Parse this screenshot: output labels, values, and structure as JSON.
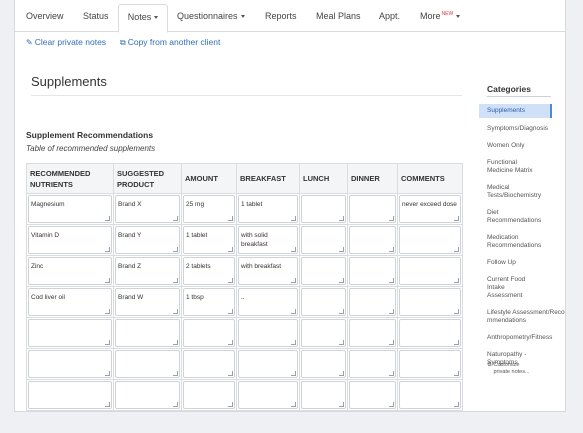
{
  "tabs": [
    {
      "label": "Overview"
    },
    {
      "label": "Status"
    },
    {
      "label": "Notes",
      "dropdown": true,
      "active": true
    },
    {
      "label": "Questionnaires",
      "dropdown": true
    },
    {
      "label": "Reports"
    },
    {
      "label": "Meal Plans"
    },
    {
      "label": "Appt."
    },
    {
      "label": "More",
      "dropdown": true,
      "badge": "NEW"
    }
  ],
  "actions": {
    "clear_label": "Clear private notes",
    "copy_label": "Copy from another client"
  },
  "page": {
    "title": "Supplements",
    "section_title": "Supplement Recommendations",
    "section_subtitle": "Table of recommended supplements"
  },
  "table": {
    "headers": [
      "RECOMMENDED NUTRIENTS",
      "SUGGESTED PRODUCT",
      "AMOUNT",
      "BREAKFAST",
      "LUNCH",
      "DINNER",
      "COMMENTS"
    ],
    "rows": [
      [
        "Magnesium",
        "Brand X",
        "25 mg",
        "1 tablet",
        "",
        "",
        "never exceed dose"
      ],
      [
        "Vitamin D",
        "Brand Y",
        "1 tablet",
        "with solid breakfast",
        "",
        "",
        ""
      ],
      [
        "Zinc",
        "Brand Z",
        "2 tablets",
        "with breakfast",
        "",
        "",
        ""
      ],
      [
        "Cod liver oil",
        "Brand W",
        "1 tbsp",
        "..",
        "",
        "",
        ""
      ],
      [
        "",
        "",
        "",
        "",
        "",
        "",
        ""
      ],
      [
        "",
        "",
        "",
        "",
        "",
        "",
        ""
      ],
      [
        "",
        "",
        "",
        "",
        "",
        "",
        ""
      ]
    ]
  },
  "sidebar": {
    "title": "Categories",
    "items": [
      {
        "label": "Supplements",
        "active": true
      },
      {
        "label": "Symptoms/Diagnosis"
      },
      {
        "label": "Women Only"
      },
      {
        "label": "Functional Medicine Matrix"
      },
      {
        "label": "Medical Tests/Biochemistry"
      },
      {
        "label": "Diet Recommendations"
      },
      {
        "label": "Medication Recommendations"
      },
      {
        "label": "Follow Up"
      },
      {
        "label": "Current Food Intake Assessment"
      },
      {
        "label": "Lifestyle Assessment/Recommendations"
      },
      {
        "label": "Anthropometry/Fitness"
      },
      {
        "label": "Naturopathy - Symptoms"
      }
    ],
    "customize_label": "Customize private notes..."
  },
  "colors": {
    "link": "#2f6fb6",
    "active_category_bg": "#cfe0f7",
    "badge_new": "#e0353d"
  }
}
